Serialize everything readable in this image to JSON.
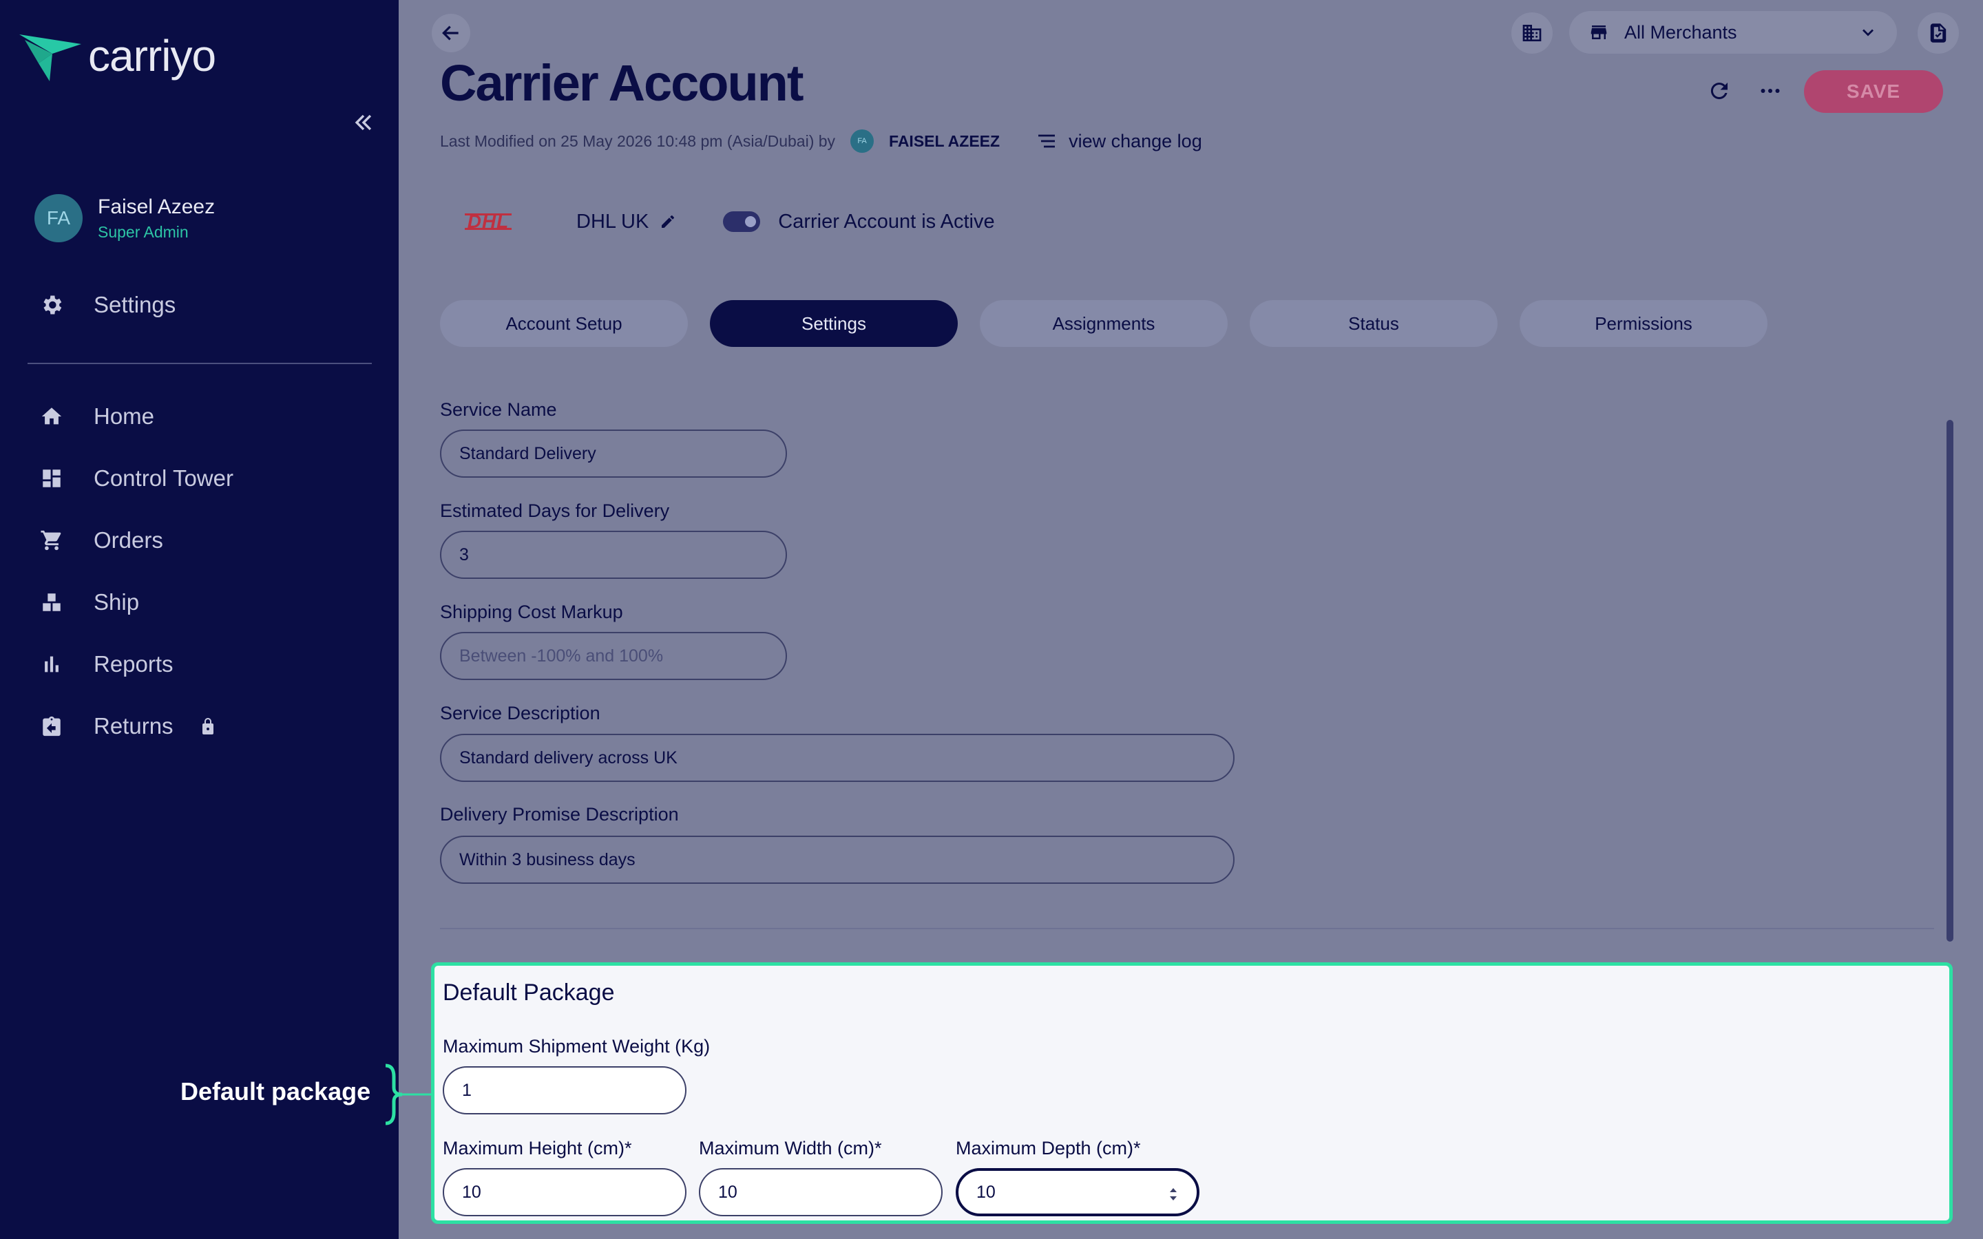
{
  "sidebar": {
    "logo_text": "carriyo",
    "user": {
      "initials": "FA",
      "name": "Faisel Azeez",
      "role": "Super Admin"
    },
    "settings_label": "Settings",
    "items": [
      {
        "label": "Home",
        "icon": "home-icon"
      },
      {
        "label": "Control Tower",
        "icon": "dashboard-icon"
      },
      {
        "label": "Orders",
        "icon": "cart-icon"
      },
      {
        "label": "Ship",
        "icon": "boxes-icon"
      },
      {
        "label": "Reports",
        "icon": "bar-chart-icon"
      },
      {
        "label": "Returns",
        "icon": "return-box-icon",
        "locked": true
      }
    ]
  },
  "annotation": {
    "label": "Default package",
    "color": "#2de0a3"
  },
  "header": {
    "merchant_select": "All Merchants",
    "title": "Carrier Account",
    "save_label": "SAVE",
    "modified_text": "Last Modified on 25 May 2026 10:48 pm (Asia/Dubai) by",
    "modified_user_initials": "FA",
    "modified_user": "FAISEL AZEEZ",
    "changelog_label": "view change log"
  },
  "carrier": {
    "logo_text": "DHL",
    "name": "DHL UK",
    "active_text": "Carrier Account is Active",
    "active": true
  },
  "tabs": [
    {
      "label": "Account Setup",
      "active": false
    },
    {
      "label": "Settings",
      "active": true
    },
    {
      "label": "Assignments",
      "active": false
    },
    {
      "label": "Status",
      "active": false
    },
    {
      "label": "Permissions",
      "active": false
    }
  ],
  "form": {
    "service_name": {
      "label": "Service Name",
      "value": "Standard Delivery"
    },
    "estimated_days": {
      "label": "Estimated Days for Delivery",
      "value": "3"
    },
    "cost_markup": {
      "label": "Shipping Cost Markup",
      "placeholder": "Between -100% and 100%"
    },
    "service_description": {
      "label": "Service Description",
      "value": "Standard delivery across UK"
    },
    "promise_description": {
      "label": "Delivery Promise Description",
      "value": "Within 3 business days"
    }
  },
  "package": {
    "title": "Default Package",
    "max_weight": {
      "label": "Maximum Shipment Weight (Kg)",
      "value": "1"
    },
    "max_height": {
      "label": "Maximum Height (cm)*",
      "value": "10"
    },
    "max_width": {
      "label": "Maximum Width (cm)*",
      "value": "10"
    },
    "max_depth": {
      "label": "Maximum Depth (cm)*",
      "value": "10"
    }
  }
}
